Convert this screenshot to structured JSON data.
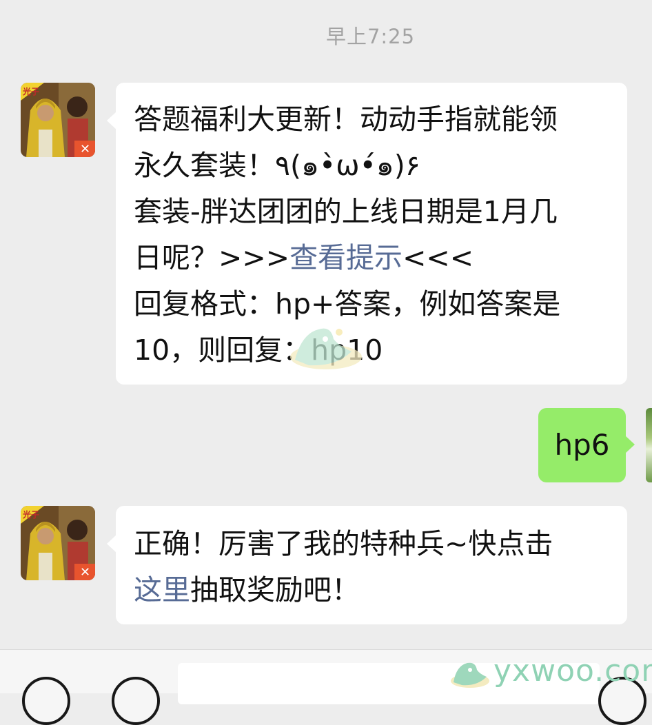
{
  "timestamp": "早上7:25",
  "messages": {
    "quiz": {
      "line1": "答题福利大更新！动动手指就能领",
      "line2": "永久套装！٩(๑•̀ω•́๑)۶",
      "line3": "套装-胖达团团的上线日期是1月几",
      "line4_prefix": "日呢？>>>",
      "line4_link": "查看提示",
      "line4_suffix": "<<<",
      "line5": "回复格式：hp+答案，例如答案是",
      "line6": "10，则回复：hp10"
    },
    "reply": {
      "text": "hp6"
    },
    "result": {
      "line1": "正确！厉害了我的特种兵~快点击",
      "line2_link": "这里",
      "line2_suffix": "抽取奖励吧！"
    }
  },
  "watermark": "yxwoo.com",
  "colors": {
    "background": "#ededed",
    "incoming_bubble": "#ffffff",
    "outgoing_bubble": "#95ec69",
    "link": "#576b95",
    "timestamp": "#a3a3a3"
  },
  "icons": {
    "bot_avatar": "game-avatar-icon",
    "voice": "voice-icon",
    "emoji": "emoji-icon",
    "more": "more-icon"
  }
}
